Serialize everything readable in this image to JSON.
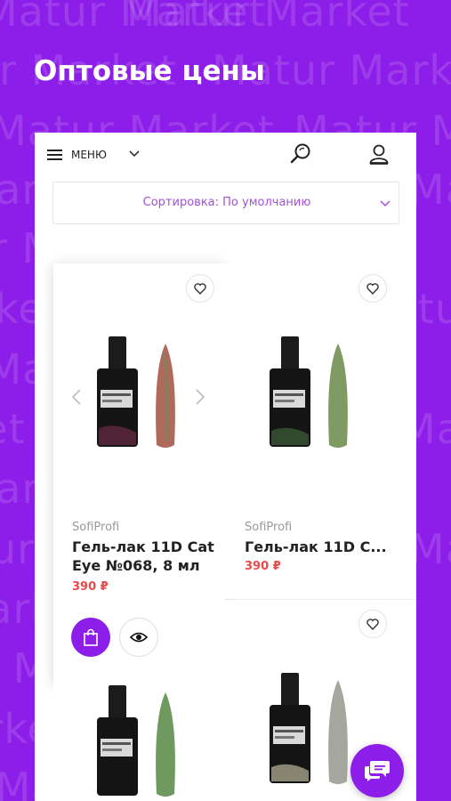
{
  "background": {
    "watermark_text": "Matur Market",
    "accent_color": "#8d1de8"
  },
  "headline": "Оптовые цены",
  "topbar": {
    "menu_label": "МЕНЮ",
    "menu_icon": "hamburger-icon",
    "chevron_icon": "chevron-down-icon",
    "search_icon": "search-icon",
    "user_icon": "user-icon"
  },
  "sort": {
    "label": "Сортировка: По умолчанию"
  },
  "products": [
    {
      "brand": "SofiProfi",
      "name_line1": "Гель-лак 11D Cat",
      "name_line2": "Eye №068, 8 мл",
      "price": "390 ₽",
      "nail_color": "#b06a5c"
    },
    {
      "brand": "SofiProfi",
      "name_line1": "Гель-лак 11D C...",
      "price": "390 ₽",
      "nail_color": "#7f9a62"
    },
    {
      "nail_color": "#6f9a5f"
    },
    {
      "nail_color": "#a5a79f"
    }
  ],
  "bottle_label": "SofiProfi"
}
